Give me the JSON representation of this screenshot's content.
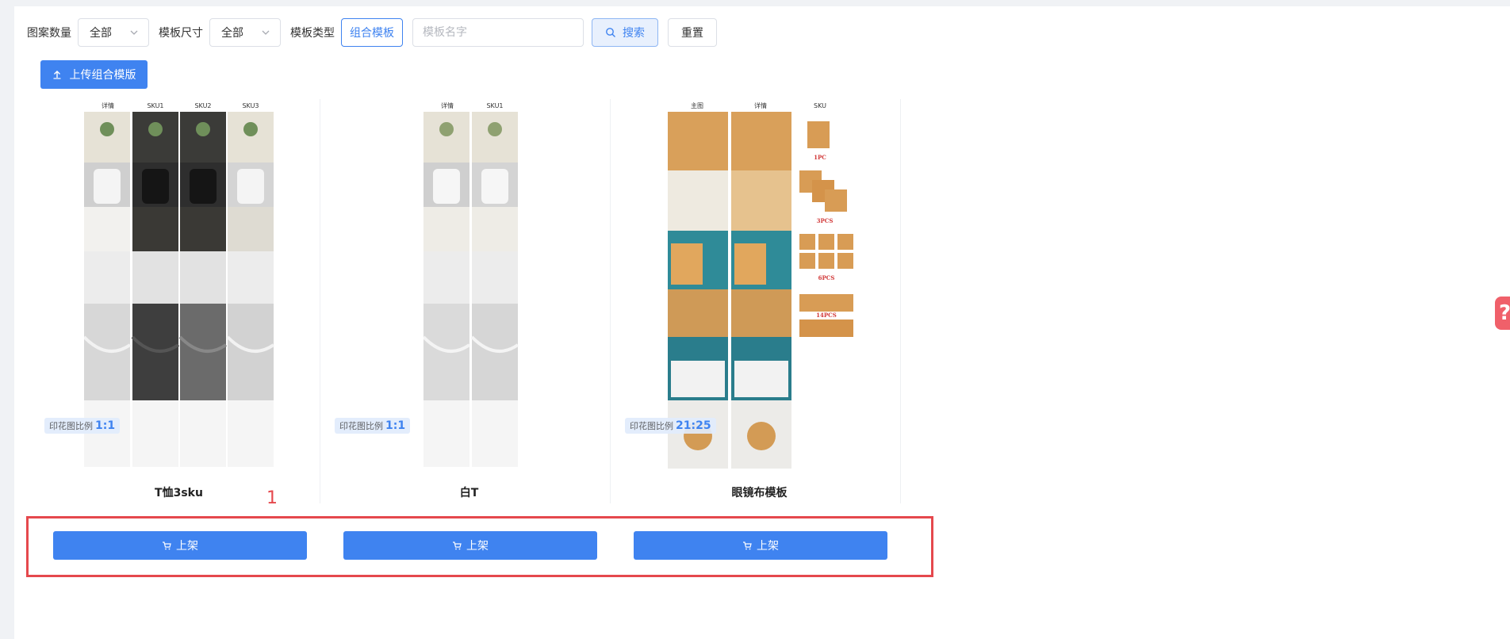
{
  "filters": {
    "pattern_count_label": "图案数量",
    "pattern_count_value": "全部",
    "template_size_label": "模板尺寸",
    "template_size_value": "全部",
    "template_type_label": "模板类型",
    "template_type_value": "组合模板",
    "name_placeholder": "模板名字",
    "search_label": "搜索",
    "reset_label": "重置"
  },
  "upload_button_label": "上传组合模版",
  "cards": [
    {
      "title": "T恤3sku",
      "ratio_label": "印花图比例",
      "ratio_value": "1:1",
      "columns": [
        "详情",
        "SKU1",
        "SKU2",
        "SKU3"
      ],
      "action_label": "上架"
    },
    {
      "title": "白T",
      "ratio_label": "印花图比例",
      "ratio_value": "1:1",
      "columns": [
        "详情",
        "SKU1"
      ],
      "action_label": "上架"
    },
    {
      "title": "眼镜布模板",
      "ratio_label": "印花图比例",
      "ratio_value": "21:25",
      "columns": [
        "主图",
        "详情",
        "SKU"
      ],
      "sku_tags": [
        "1PC",
        "3PCS",
        "6PCS",
        "14PCS"
      ],
      "action_label": "上架"
    }
  ],
  "annotation_number": "1",
  "help_icon_glyph": "?",
  "colors": {
    "primary": "#3f83f0",
    "annotation": "#e5484d",
    "help": "#f0606a"
  }
}
